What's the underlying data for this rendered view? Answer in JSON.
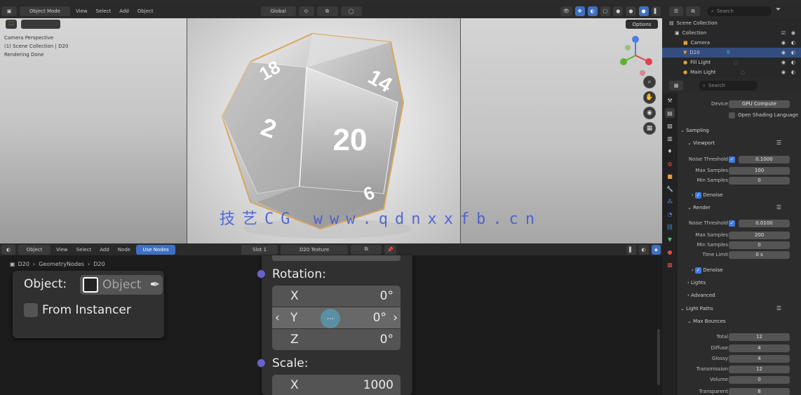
{
  "viewport_header": {
    "mode": "Object Mode",
    "menus": [
      "View",
      "Select",
      "Add",
      "Object"
    ],
    "orientation": "Global"
  },
  "viewport": {
    "info_lines": [
      "Camera Perspective",
      "(1) Scene Collection | D20",
      "Rendering Done"
    ],
    "camera_button": "Options",
    "die_faces": [
      "20",
      "14",
      "18",
      "2",
      "6"
    ],
    "watermark": "技艺CG www.qdnxxfb.cn"
  },
  "editor_header": {
    "menus": [
      "Object",
      "View",
      "Select",
      "Add",
      "Node",
      "Use Nodes"
    ],
    "slot": "Slot 1",
    "material": "D20 Texture"
  },
  "breadcrumb": [
    "D20",
    "GeometryNodes",
    "D20"
  ],
  "node_object_info": {
    "object_label": "Object:",
    "object_placeholder": "Object",
    "from_instancer": "From Instancer"
  },
  "node_transform": {
    "rotation_label": "Rotation:",
    "rotation": [
      {
        "axis": "X",
        "value": "0°"
      },
      {
        "axis": "Y",
        "value": "0°"
      },
      {
        "axis": "Z",
        "value": "0°"
      }
    ],
    "scale_label": "Scale:",
    "scale": [
      {
        "axis": "X",
        "value": "1000"
      }
    ],
    "ellipsis": "···"
  },
  "outliner": {
    "search_placeholder": "Search",
    "items": [
      {
        "name": "Scene Collection"
      },
      {
        "name": "Collection"
      },
      {
        "name": "Camera"
      },
      {
        "name": "D20"
      },
      {
        "name": "Fill Light"
      },
      {
        "name": "Main Light"
      }
    ]
  },
  "properties": {
    "search_placeholder": "Search",
    "device_label": "Device",
    "device_value": "GPU Compute",
    "open_shading": "Open Shading Language",
    "sampling_title": "Sampling",
    "viewport_title": "Viewport",
    "render_title": "Render",
    "viewport_rows": [
      {
        "label": "Noise Threshold",
        "value": "0.1000"
      },
      {
        "label": "Max Samples",
        "value": "100"
      },
      {
        "label": "Min Samples",
        "value": "0"
      }
    ],
    "denoise_label": "Denoise",
    "render_rows": [
      {
        "label": "Noise Threshold",
        "value": "0.0100"
      },
      {
        "label": "Max Samples",
        "value": "200"
      },
      {
        "label": "Min Samples",
        "value": "0"
      },
      {
        "label": "Time Limit",
        "value": "0 s"
      }
    ],
    "denoise2_label": "Denoise",
    "lights_title": "Lights",
    "advanced_title": "Advanced",
    "light_paths_title": "Light Paths",
    "max_bounces_title": "Max Bounces",
    "bounce_rows": [
      {
        "label": "Total",
        "value": "12"
      },
      {
        "label": "Diffuse",
        "value": "4"
      },
      {
        "label": "Glossy",
        "value": "4"
      },
      {
        "label": "Transmission",
        "value": "12"
      },
      {
        "label": "Volume",
        "value": "0"
      },
      {
        "label": "Transparent",
        "value": "8"
      }
    ]
  },
  "colors": {
    "accent": "#3f6fc0",
    "socket": "#6a62c9",
    "selection": "#334d80",
    "watermark": "#3d57d6"
  }
}
